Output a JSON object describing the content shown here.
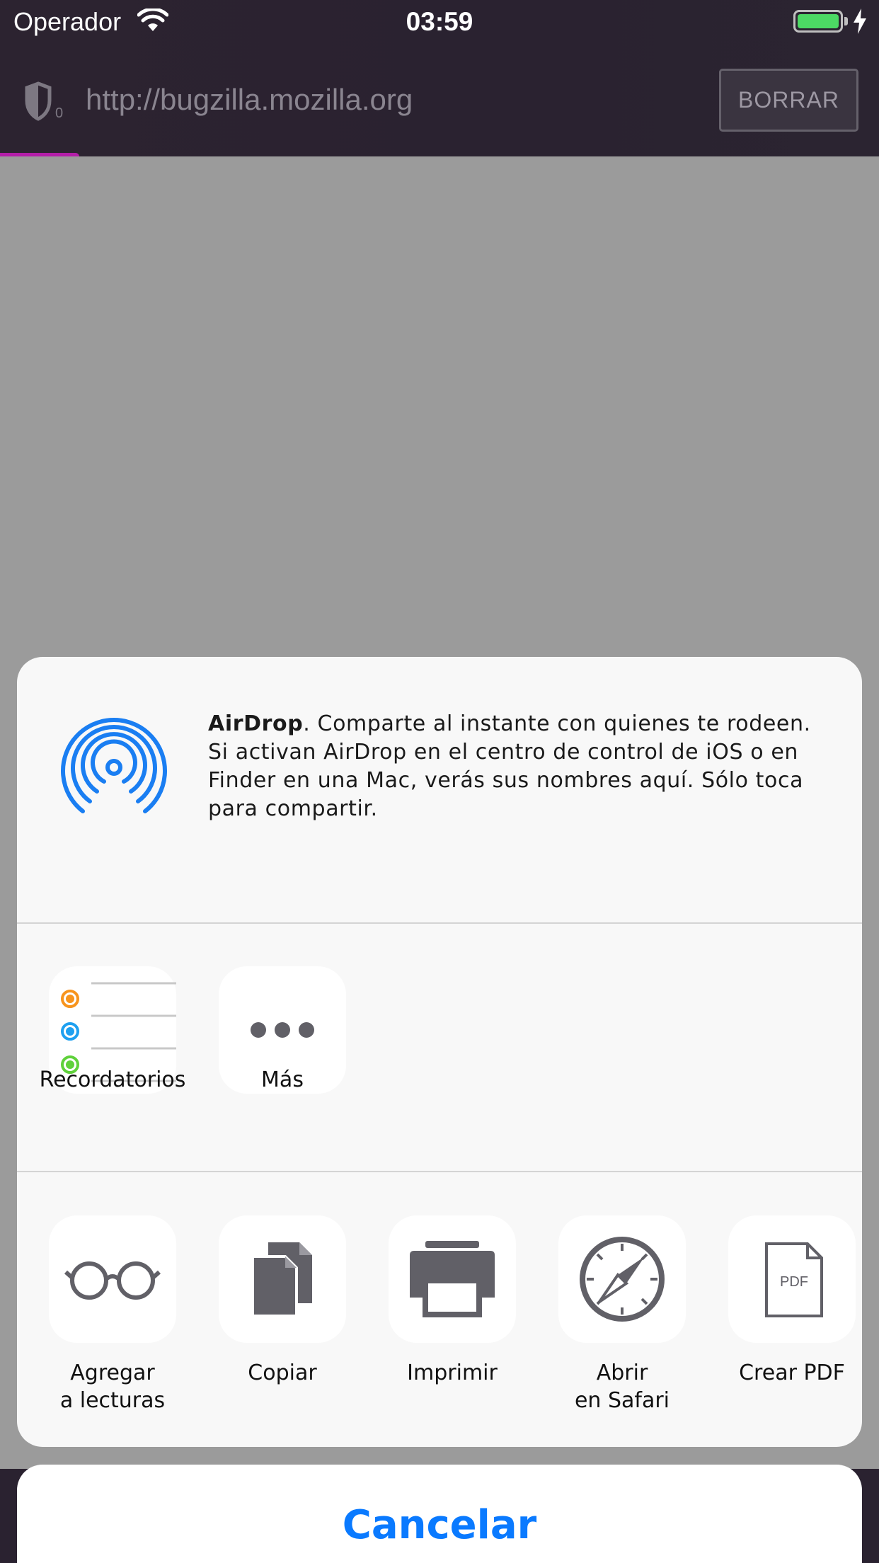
{
  "status_bar": {
    "carrier": "Operador",
    "time": "03:59",
    "battery_level": 1.0
  },
  "browser": {
    "url": "http://bugzilla.mozilla.org",
    "tracker_count": "0",
    "erase_label": "BORRAR",
    "load_progress": 0.09,
    "accent_color": "#b31ea8"
  },
  "share_sheet": {
    "airdrop": {
      "title": "AirDrop",
      "description": ". Comparte al instante con quienes te rodeen. Si activan AirDrop en el centro de control de iOS o en Finder en una Mac, verás sus nombres aquí. Sólo toca para compartir.",
      "icon": "airdrop-icon",
      "color": "#1a7ef2"
    },
    "apps": [
      {
        "label": "Recordatorios",
        "icon": "reminders-icon"
      },
      {
        "label": "Más",
        "icon": "more-icon"
      }
    ],
    "actions": [
      {
        "label_line1": "Agregar",
        "label_line2": "a lecturas",
        "icon": "glasses-icon"
      },
      {
        "label_line1": "Copiar",
        "label_line2": "",
        "icon": "copy-icon"
      },
      {
        "label_line1": "Imprimir",
        "label_line2": "",
        "icon": "printer-icon"
      },
      {
        "label_line1": "Abrir",
        "label_line2": "en Safari",
        "icon": "compass-icon"
      },
      {
        "label_line1": "Crear PDF",
        "label_line2": "",
        "icon": "pdf-icon",
        "icon_text": "PDF"
      }
    ],
    "cancel_label": "Cancelar"
  }
}
